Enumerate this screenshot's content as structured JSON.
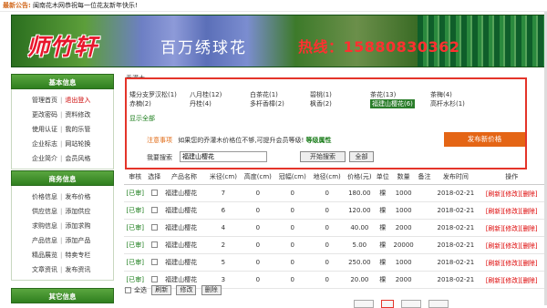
{
  "announcement": {
    "label": "最新公告:",
    "text": "闽南花木网恭祝每一位花友新年快乐!"
  },
  "banner": {
    "logo": "师竹轩",
    "slogan": "百万绣球花",
    "hotline": "热线：15880830362"
  },
  "sidebar": {
    "basic": {
      "title": "基本信息",
      "rows": [
        [
          "管理首页",
          "退出登入"
        ],
        [
          "更改密码",
          "资料修改"
        ],
        [
          "使用认证",
          "我的乐管"
        ],
        [
          "企业标志",
          "网站轮换"
        ],
        [
          "企业简介",
          "会员风格"
        ]
      ]
    },
    "business": {
      "title": "商务信息",
      "rows": [
        [
          "价格信息",
          "发布价格"
        ],
        [
          "供应信息",
          "添加供应"
        ],
        [
          "求购信息",
          "添加求购"
        ],
        [
          "产品信息",
          "添加产品"
        ],
        [
          "精品展览",
          "特卖专栏"
        ],
        [
          "文章资讯",
          "发布资讯"
        ]
      ]
    },
    "other": {
      "title": "其它信息"
    }
  },
  "category": {
    "label": "乔灌木"
  },
  "categories": [
    {
      "label": "矮分支罗汉松(1)",
      "selected": false
    },
    {
      "label": "八月桂(12)",
      "selected": false
    },
    {
      "label": "白茶花(1)",
      "selected": false
    },
    {
      "label": "碧桃(1)",
      "selected": false
    },
    {
      "label": "茶花(13)",
      "selected": false
    },
    {
      "label": "茶梅(4)",
      "selected": false
    },
    {
      "label": "赤楠(2)",
      "selected": false
    },
    {
      "label": "丹桂(4)",
      "selected": false
    },
    {
      "label": "多杆香樟(2)",
      "selected": false
    },
    {
      "label": "枫香(2)",
      "selected": false
    },
    {
      "label": "福建山樱花(6)",
      "selected": true
    },
    {
      "label": "高杆水杉(1)",
      "selected": false
    }
  ],
  "show_all": "显示全部",
  "notice": {
    "label": "注意事项",
    "text": "如果您的乔灌木价格位不够,可提升会员等级!",
    "link": "等级属性"
  },
  "publish_button": "发布新价格",
  "search": {
    "label": "我要搜索",
    "value": "福建山樱花",
    "submit": "开始搜索",
    "all": "全部"
  },
  "table": {
    "headers": [
      "审核",
      "选择",
      "产品名称",
      "米径(cm)",
      "高度(cm)",
      "冠幅(cm)",
      "地径(cm)",
      "价格(元)",
      "单位",
      "数量",
      "备注",
      "发布时间",
      "操作"
    ],
    "rows": [
      {
        "status": "[已审]",
        "name": "福建山樱花",
        "mijing": "7",
        "height": "0",
        "crown": "0",
        "ground": "0",
        "price": "180.00",
        "unit": "棵",
        "qty": "1000",
        "note": "",
        "date": "2018-02-21"
      },
      {
        "status": "[已审]",
        "name": "福建山樱花",
        "mijing": "6",
        "height": "0",
        "crown": "0",
        "ground": "0",
        "price": "120.00",
        "unit": "棵",
        "qty": "1000",
        "note": "",
        "date": "2018-02-21"
      },
      {
        "status": "[已审]",
        "name": "福建山樱花",
        "mijing": "4",
        "height": "0",
        "crown": "0",
        "ground": "0",
        "price": "40.00",
        "unit": "棵",
        "qty": "2000",
        "note": "",
        "date": "2018-02-21"
      },
      {
        "status": "[已审]",
        "name": "福建山樱花",
        "mijing": "2",
        "height": "0",
        "crown": "0",
        "ground": "0",
        "price": "5.00",
        "unit": "棵",
        "qty": "20000",
        "note": "",
        "date": "2018-02-21"
      },
      {
        "status": "[已审]",
        "name": "福建山樱花",
        "mijing": "5",
        "height": "0",
        "crown": "0",
        "ground": "0",
        "price": "250.00",
        "unit": "棵",
        "qty": "1000",
        "note": "",
        "date": "2018-02-21"
      },
      {
        "status": "[已审]",
        "name": "福建山樱花",
        "mijing": "3",
        "height": "0",
        "crown": "0",
        "ground": "0",
        "price": "20.00",
        "unit": "棵",
        "qty": "2000",
        "note": "",
        "date": "2018-02-21"
      }
    ],
    "ops": {
      "refresh": "[刷新]",
      "edit": "[修改]",
      "delete": "[删除]"
    }
  },
  "footer": {
    "select_all": "全选",
    "refresh": "刷新",
    "edit": "修改",
    "delete": "删除"
  }
}
